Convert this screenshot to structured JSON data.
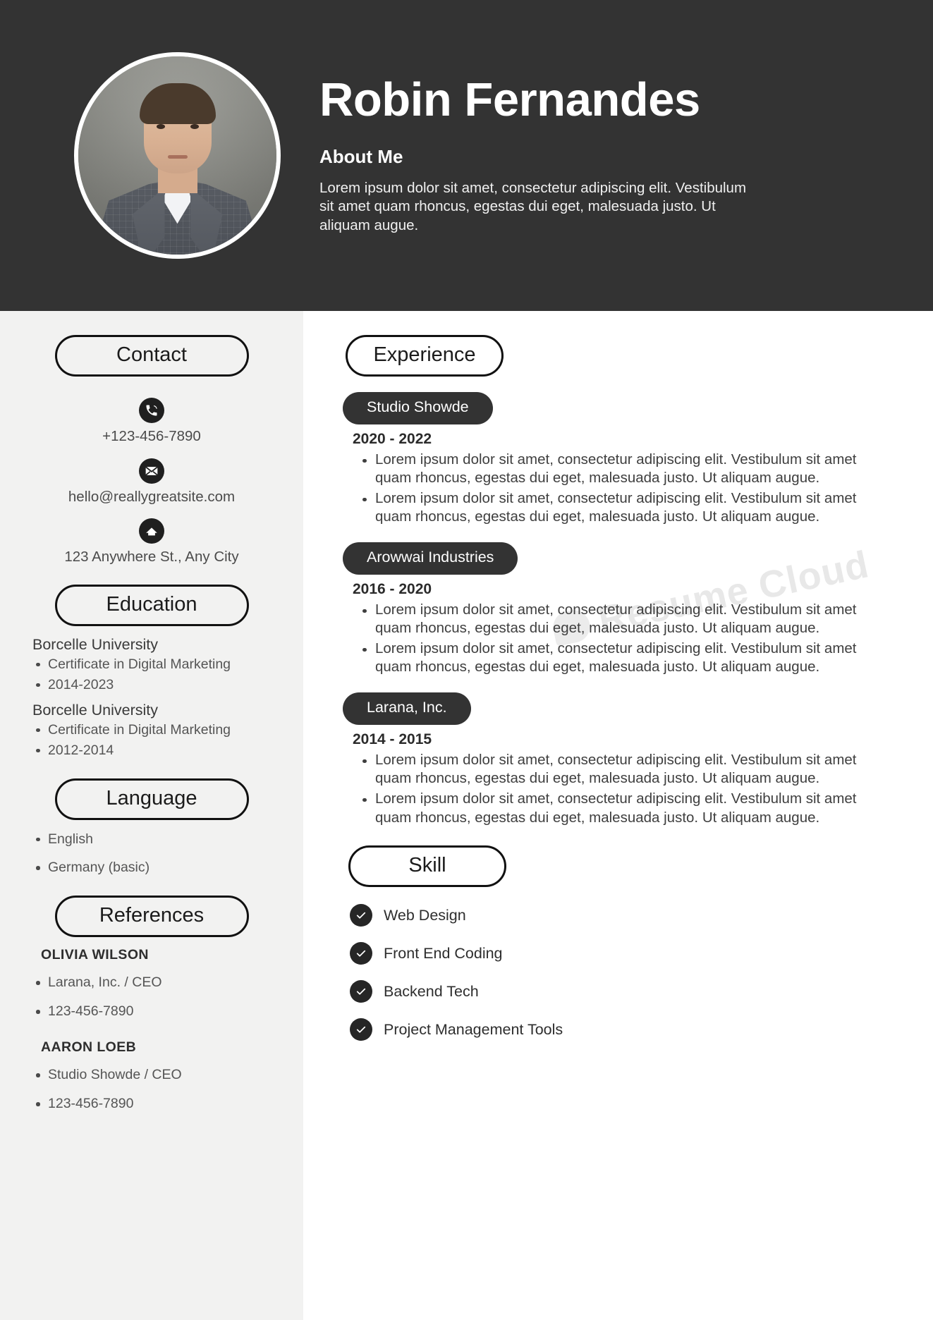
{
  "header": {
    "name": "Robin Fernandes",
    "about_title": "About Me",
    "about_text": "Lorem ipsum dolor sit amet, consectetur adipiscing elit. Vestibulum sit amet quam rhoncus, egestas dui eget, malesuada justo. Ut aliquam augue.",
    "background_color": "#333333"
  },
  "watermark": {
    "text": "Resume Cloud"
  },
  "sidebar": {
    "contact": {
      "heading": "Contact",
      "items": [
        {
          "icon": "phone-icon",
          "value": "+123-456-7890"
        },
        {
          "icon": "email-icon",
          "value": "hello@reallygreatsite.com"
        },
        {
          "icon": "home-icon",
          "value": "123 Anywhere St., Any City"
        }
      ]
    },
    "education": {
      "heading": "Education",
      "entries": [
        {
          "school": "Borcelle University",
          "bullets": [
            "Certificate in Digital Marketing",
            "2014-2023"
          ]
        },
        {
          "school": "Borcelle University",
          "bullets": [
            "Certificate in Digital Marketing",
            "2012-2014"
          ]
        }
      ]
    },
    "language": {
      "heading": "Language",
      "items": [
        "English",
        "Germany (basic)"
      ]
    },
    "references": {
      "heading": "References",
      "entries": [
        {
          "name": "OLIVIA WILSON",
          "bullets": [
            "Larana, Inc. / CEO",
            "123-456-7890"
          ]
        },
        {
          "name": "AARON LOEB",
          "bullets": [
            "Studio Showde / CEO",
            "123-456-7890"
          ]
        }
      ]
    }
  },
  "main": {
    "experience": {
      "heading": "Experience",
      "jobs": [
        {
          "company": "Studio Showde",
          "dates": "2020 - 2022",
          "bullets": [
            "Lorem ipsum dolor sit amet, consectetur adipiscing elit. Vestibulum sit amet quam rhoncus, egestas dui eget, malesuada justo. Ut aliquam augue.",
            "Lorem ipsum dolor sit amet, consectetur adipiscing elit. Vestibulum sit amet quam rhoncus, egestas dui eget, malesuada justo. Ut aliquam augue."
          ]
        },
        {
          "company": "Arowwai Industries",
          "dates": "2016 - 2020",
          "bullets": [
            "Lorem ipsum dolor sit amet, consectetur adipiscing elit. Vestibulum sit amet quam rhoncus, egestas dui eget, malesuada justo. Ut aliquam augue.",
            "Lorem ipsum dolor sit amet, consectetur adipiscing elit. Vestibulum sit amet quam rhoncus, egestas dui eget, malesuada justo. Ut aliquam augue."
          ]
        },
        {
          "company": "Larana, Inc.",
          "dates": "2014 - 2015",
          "bullets": [
            "Lorem ipsum dolor sit amet, consectetur adipiscing elit. Vestibulum sit amet quam rhoncus, egestas dui eget, malesuada justo. Ut aliquam augue.",
            "Lorem ipsum dolor sit amet, consectetur adipiscing elit. Vestibulum sit amet quam rhoncus, egestas dui eget, malesuada justo. Ut aliquam augue."
          ]
        }
      ]
    },
    "skill": {
      "heading": "Skill",
      "items": [
        "Web Design",
        "Front End Coding",
        "Backend Tech",
        "Project Management Tools"
      ]
    }
  }
}
